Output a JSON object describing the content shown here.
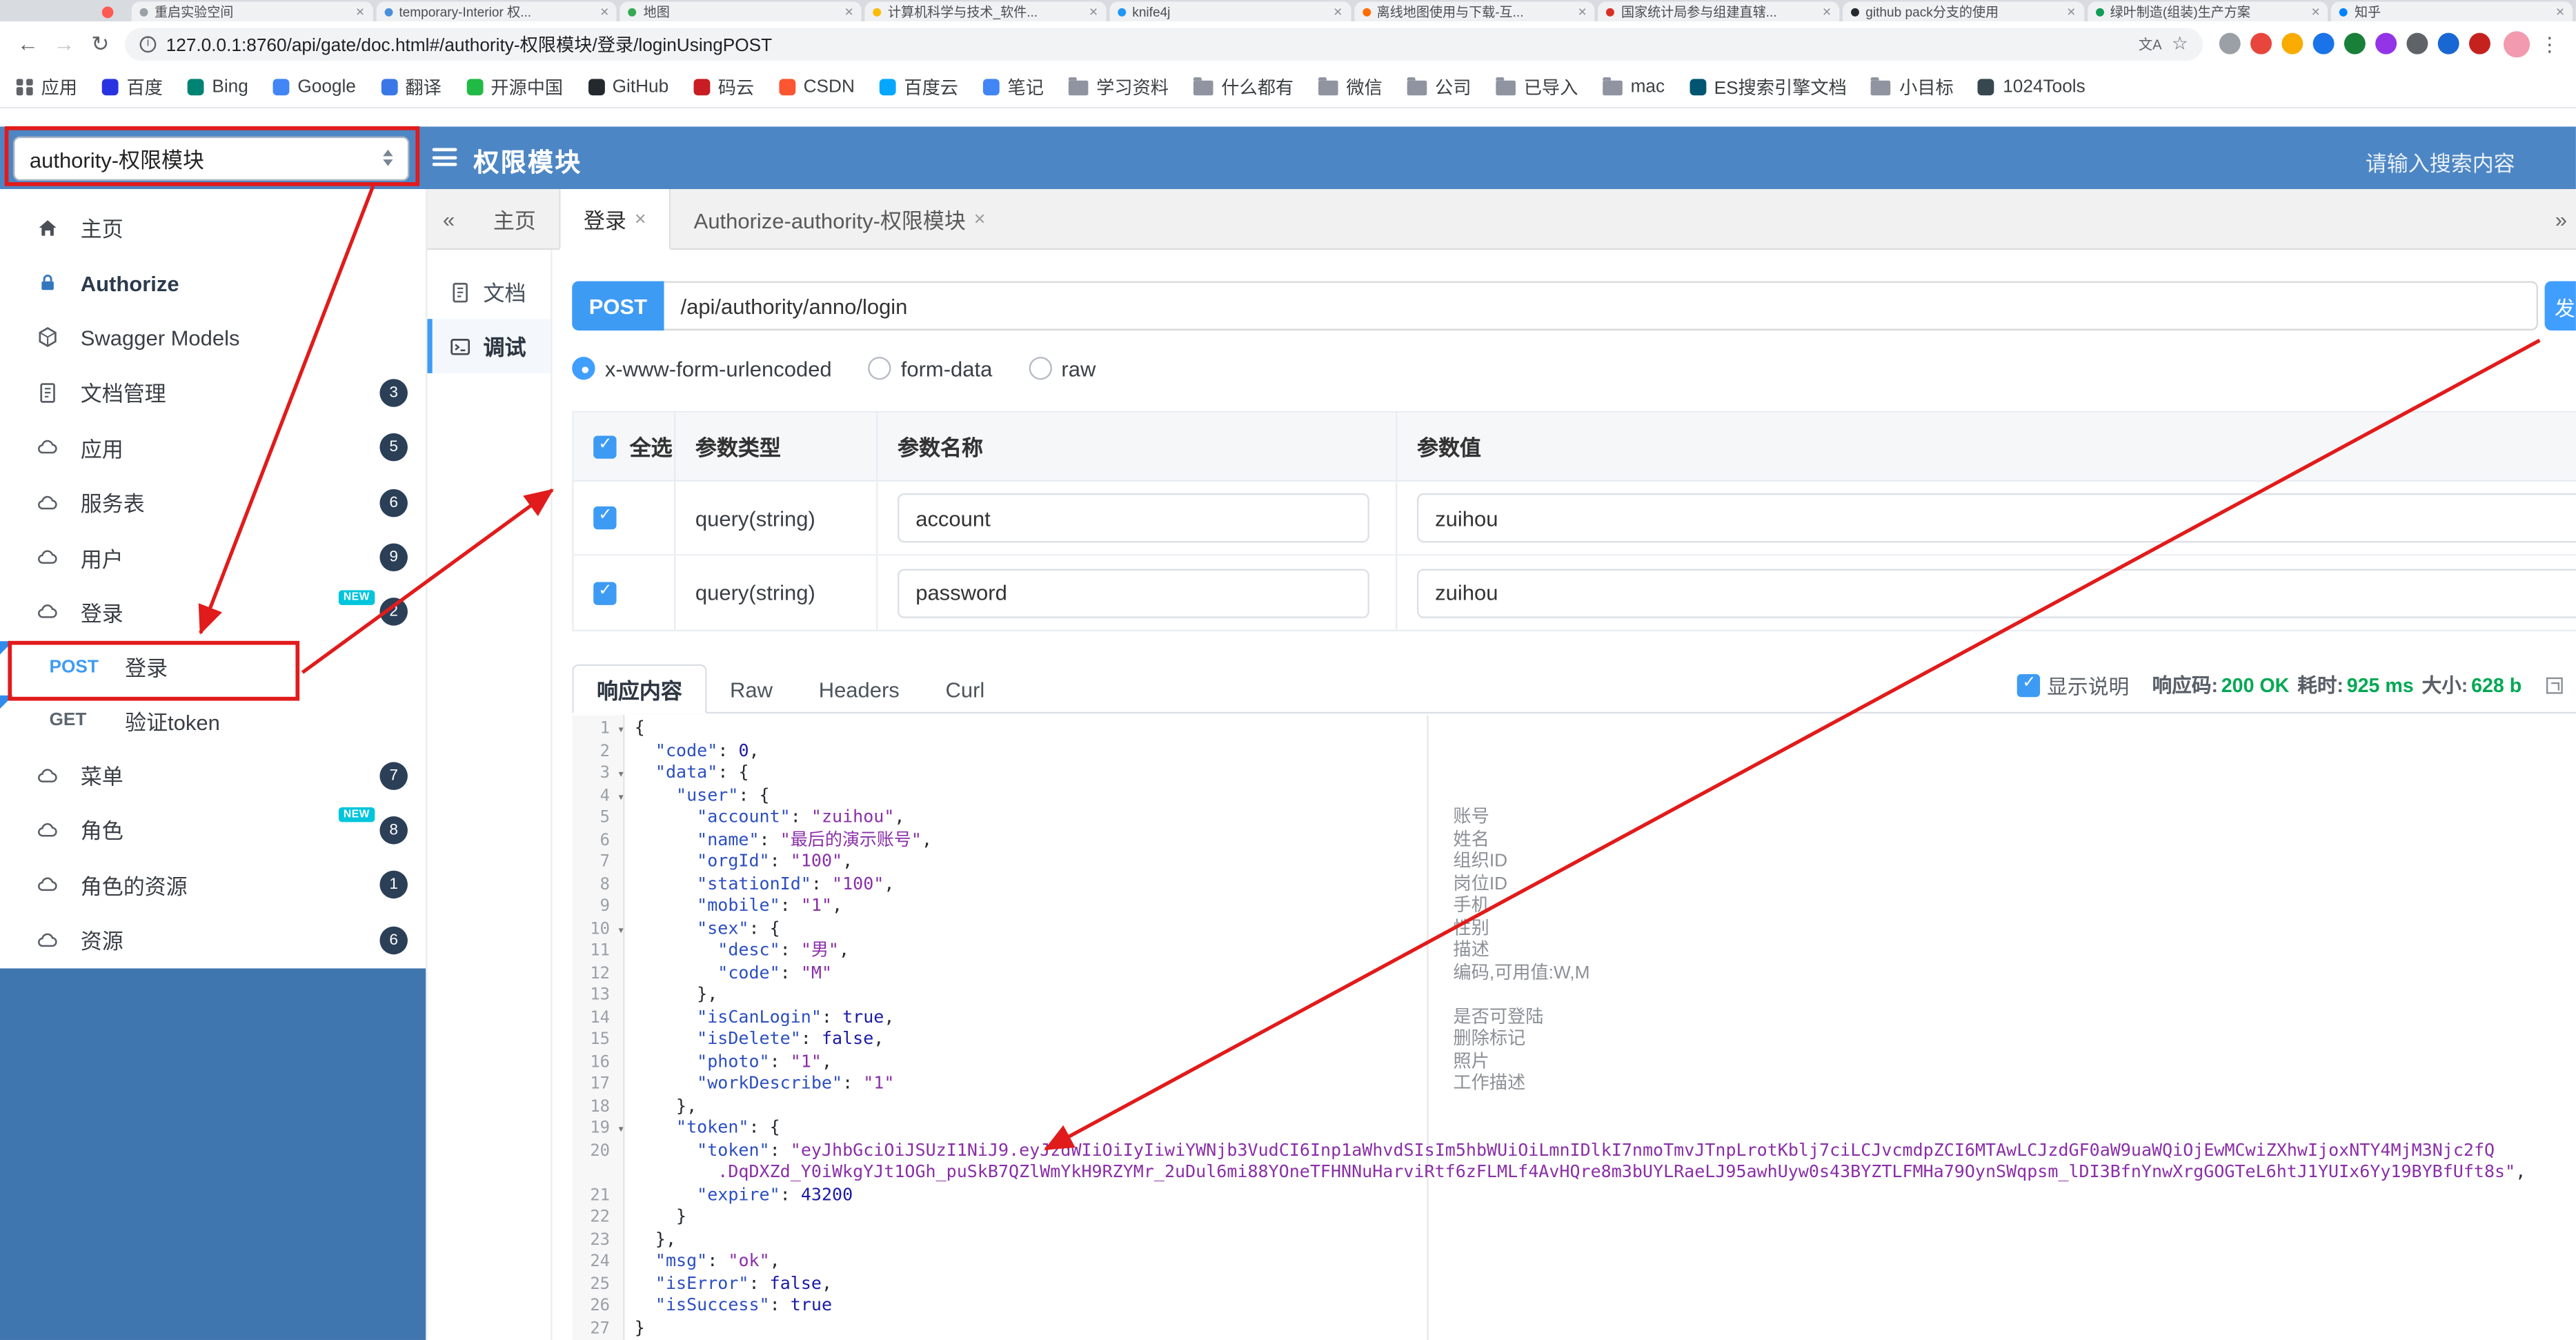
{
  "browser": {
    "tabs": [
      {
        "title": "重启实验空间",
        "color": "#9aa0a6"
      },
      {
        "title": "temporary-Interior 权...",
        "color": "#4a90d9"
      },
      {
        "title": "地图",
        "color": "#34a853"
      },
      {
        "title": "计算机科学与技术_软件...",
        "color": "#fbbc04"
      },
      {
        "title": "knife4j",
        "color": "#2196f3"
      },
      {
        "title": "离线地图使用与下载-互...",
        "color": "#ff6d00"
      },
      {
        "title": "国家统计局参与组建直辖...",
        "color": "#d93025"
      },
      {
        "title": "github pack分支的使用",
        "color": "#24292e"
      },
      {
        "title": "绿叶制造(组装)生产方案",
        "color": "#0f9d58"
      },
      {
        "title": "知乎",
        "color": "#0084ff"
      }
    ],
    "toolbar": {
      "back": "←",
      "forward": "→",
      "reload": "↻",
      "url": "127.0.0.1:8760/api/gate/doc.html#/authority-权限模块/登录/loginUsingPOST",
      "translate_hint": "文A",
      "star": "☆",
      "menu": "⋮",
      "extensions": [
        {
          "color": "#9aa0a6"
        },
        {
          "color": "#e8453c"
        },
        {
          "color": "#f9ab00"
        },
        {
          "color": "#1a73e8"
        },
        {
          "color": "#188038"
        },
        {
          "color": "#9334e6"
        },
        {
          "color": "#5f6368"
        },
        {
          "color": "#1967d2"
        },
        {
          "color": "#c5221f"
        }
      ]
    },
    "bookmarks": [
      {
        "label": "应用",
        "icon": "apps-icon"
      },
      {
        "label": "百度",
        "icon": "site-icon",
        "color": "#2932e1"
      },
      {
        "label": "Bing",
        "icon": "site-icon",
        "color": "#008373"
      },
      {
        "label": "Google",
        "icon": "site-icon",
        "color": "#4285f4"
      },
      {
        "label": "翻译",
        "icon": "site-icon",
        "color": "#3b78e7"
      },
      {
        "label": "开源中国",
        "icon": "site-icon",
        "color": "#21ba45"
      },
      {
        "label": "GitHub",
        "icon": "site-icon",
        "color": "#24292e"
      },
      {
        "label": "码云",
        "icon": "site-icon",
        "color": "#c71d23"
      },
      {
        "label": "CSDN",
        "icon": "site-icon",
        "color": "#fc5531"
      },
      {
        "label": "百度云",
        "icon": "site-icon",
        "color": "#06a7ff"
      },
      {
        "label": "笔记",
        "icon": "site-icon",
        "color": "#4285f4"
      },
      {
        "label": "学习资料",
        "icon": "folder-icon"
      },
      {
        "label": "什么都有",
        "icon": "folder-icon"
      },
      {
        "label": "微信",
        "icon": "folder-icon"
      },
      {
        "label": "公司",
        "icon": "folder-icon"
      },
      {
        "label": "已导入",
        "icon": "folder-icon"
      },
      {
        "label": "mac",
        "icon": "folder-icon"
      },
      {
        "label": "ES搜索引擎文档",
        "icon": "site-icon",
        "color": "#005571"
      },
      {
        "label": "小目标",
        "icon": "folder-icon"
      },
      {
        "label": "1024Tools",
        "icon": "site-icon",
        "color": "#37474f"
      }
    ]
  },
  "header": {
    "module_select": "authority-权限模块",
    "title": "权限模块",
    "search_placeholder": "请输入搜索内容"
  },
  "sidebar": {
    "new_label": "NEW",
    "items": [
      {
        "label": "主页",
        "icon": "home-icon"
      },
      {
        "label": "Authorize",
        "icon": "lock-icon",
        "bold": true
      },
      {
        "label": "Swagger Models",
        "icon": "models-icon"
      },
      {
        "label": "文档管理",
        "icon": "doc-icon",
        "badge": "3"
      },
      {
        "label": "应用",
        "icon": "cloud-icon",
        "badge": "5"
      },
      {
        "label": "服务表",
        "icon": "cloud-icon",
        "badge": "6"
      },
      {
        "label": "用户",
        "icon": "cloud-icon",
        "badge": "9"
      },
      {
        "label": "登录",
        "icon": "cloud-icon",
        "badge": "2",
        "new": true
      },
      {
        "method": "POST",
        "label": "登录",
        "boxed": true
      },
      {
        "method": "GET",
        "label": "验证token"
      },
      {
        "label": "菜单",
        "icon": "cloud-icon",
        "badge": "7"
      },
      {
        "label": "角色",
        "icon": "cloud-icon",
        "badge": "8",
        "new": true
      },
      {
        "label": "角色的资源",
        "icon": "cloud-icon",
        "badge": "1"
      },
      {
        "label": "资源",
        "icon": "cloud-icon",
        "badge": "6"
      }
    ]
  },
  "tabs_bar": {
    "collapse_left": "«",
    "collapse_right": "»",
    "close_glyph": "×",
    "items": [
      {
        "label": "主页",
        "closable": false,
        "active": false
      },
      {
        "label": "登录",
        "closable": true,
        "active": true
      },
      {
        "label": "Authorize-authority-权限模块",
        "closable": true,
        "active": false
      }
    ]
  },
  "doc_rail": {
    "items": [
      {
        "label": "文档",
        "icon": "doc-icon",
        "active": false
      },
      {
        "label": "调试",
        "icon": "debug-icon",
        "active": true
      }
    ]
  },
  "debug": {
    "method": "POST",
    "url": "/api/authority/anno/login",
    "send_label": "发送",
    "content_types": [
      {
        "label": "x-www-form-urlencoded",
        "selected": true
      },
      {
        "label": "form-data",
        "selected": false
      },
      {
        "label": "raw",
        "selected": false
      }
    ],
    "params": {
      "select_all_label": "全选",
      "select_all_checked": true,
      "columns": [
        "参数类型",
        "参数名称",
        "参数值"
      ],
      "rows": [
        {
          "checked": true,
          "type": "query(string)",
          "name": "account",
          "value": "zuihou"
        },
        {
          "checked": true,
          "type": "query(string)",
          "name": "password",
          "value": "zuihou"
        }
      ]
    },
    "response": {
      "tabs": [
        {
          "label": "响应内容",
          "active": true
        },
        {
          "label": "Raw",
          "active": false
        },
        {
          "label": "Headers",
          "active": false
        },
        {
          "label": "Curl",
          "active": false
        }
      ],
      "show_desc": {
        "checked": true,
        "label": "显示说明"
      },
      "status": [
        {
          "label": "响应码:",
          "value": "200 OK"
        },
        {
          "label": "耗时:",
          "value": "925 ms"
        },
        {
          "label": "大小:",
          "value": "628 b"
        }
      ]
    }
  },
  "code": {
    "lines": [
      {
        "n": "1",
        "f": true,
        "s": [
          [
            "p",
            "{"
          ]
        ]
      },
      {
        "n": "2",
        "s": [
          [
            "p",
            "  "
          ],
          [
            "k",
            "\"code\""
          ],
          [
            "p",
            ": "
          ],
          [
            "d",
            "0"
          ],
          [
            "p",
            ","
          ]
        ]
      },
      {
        "n": "3",
        "f": true,
        "s": [
          [
            "p",
            "  "
          ],
          [
            "k",
            "\"data\""
          ],
          [
            "p",
            ": {"
          ]
        ]
      },
      {
        "n": "4",
        "f": true,
        "s": [
          [
            "p",
            "    "
          ],
          [
            "k",
            "\"user\""
          ],
          [
            "p",
            ": {"
          ]
        ]
      },
      {
        "n": "5",
        "s": [
          [
            "p",
            "      "
          ],
          [
            "k",
            "\"account\""
          ],
          [
            "p",
            ": "
          ],
          [
            "s",
            "\"zuihou\""
          ],
          [
            "p",
            ","
          ]
        ]
      },
      {
        "n": "6",
        "s": [
          [
            "p",
            "      "
          ],
          [
            "k",
            "\"name\""
          ],
          [
            "p",
            ": "
          ],
          [
            "s",
            "\"最后的演示账号\""
          ],
          [
            "p",
            ","
          ]
        ]
      },
      {
        "n": "7",
        "s": [
          [
            "p",
            "      "
          ],
          [
            "k",
            "\"orgId\""
          ],
          [
            "p",
            ": "
          ],
          [
            "s",
            "\"100\""
          ],
          [
            "p",
            ","
          ]
        ]
      },
      {
        "n": "8",
        "s": [
          [
            "p",
            "      "
          ],
          [
            "k",
            "\"stationId\""
          ],
          [
            "p",
            ": "
          ],
          [
            "s",
            "\"100\""
          ],
          [
            "p",
            ","
          ]
        ]
      },
      {
        "n": "9",
        "s": [
          [
            "p",
            "      "
          ],
          [
            "k",
            "\"mobile\""
          ],
          [
            "p",
            ": "
          ],
          [
            "s",
            "\"1\""
          ],
          [
            "p",
            ","
          ]
        ]
      },
      {
        "n": "10",
        "f": true,
        "s": [
          [
            "p",
            "      "
          ],
          [
            "k",
            "\"sex\""
          ],
          [
            "p",
            ": {"
          ]
        ]
      },
      {
        "n": "11",
        "s": [
          [
            "p",
            "        "
          ],
          [
            "k",
            "\"desc\""
          ],
          [
            "p",
            ": "
          ],
          [
            "s",
            "\"男\""
          ],
          [
            "p",
            ","
          ]
        ]
      },
      {
        "n": "12",
        "s": [
          [
            "p",
            "        "
          ],
          [
            "k",
            "\"code\""
          ],
          [
            "p",
            ": "
          ],
          [
            "s",
            "\"M\""
          ]
        ]
      },
      {
        "n": "13",
        "s": [
          [
            "p",
            "      },"
          ]
        ]
      },
      {
        "n": "14",
        "s": [
          [
            "p",
            "      "
          ],
          [
            "k",
            "\"isCanLogin\""
          ],
          [
            "p",
            ": "
          ],
          [
            "b",
            "true"
          ],
          [
            "p",
            ","
          ]
        ]
      },
      {
        "n": "15",
        "s": [
          [
            "p",
            "      "
          ],
          [
            "k",
            "\"isDelete\""
          ],
          [
            "p",
            ": "
          ],
          [
            "b",
            "false"
          ],
          [
            "p",
            ","
          ]
        ]
      },
      {
        "n": "16",
        "s": [
          [
            "p",
            "      "
          ],
          [
            "k",
            "\"photo\""
          ],
          [
            "p",
            ": "
          ],
          [
            "s",
            "\"1\""
          ],
          [
            "p",
            ","
          ]
        ]
      },
      {
        "n": "17",
        "s": [
          [
            "p",
            "      "
          ],
          [
            "k",
            "\"workDescribe\""
          ],
          [
            "p",
            ": "
          ],
          [
            "s",
            "\"1\""
          ]
        ]
      },
      {
        "n": "18",
        "s": [
          [
            "p",
            "    },"
          ]
        ]
      },
      {
        "n": "19",
        "f": true,
        "s": [
          [
            "p",
            "    "
          ],
          [
            "k",
            "\"token\""
          ],
          [
            "p",
            ": {"
          ]
        ]
      },
      {
        "n": "20",
        "s": [
          [
            "p",
            "      "
          ],
          [
            "k",
            "\"token\""
          ],
          [
            "p",
            ": "
          ],
          [
            "s",
            "\"eyJhbGciOiJSUzI1NiJ9.eyJzdWIiOiIyIiwiYWNjb3VudCI6Inp1aWhvdSIsIm5hbWUiOiLmnIDlkI7nmoTmvJTnpLrotKblj7ciLCJvcmdpZCI6MTAwLCJzdGF0aW9uaWQiOjEwMCwiZXhwIjoxNTY4MjM3Njc2fQ"
          ]
        ]
      },
      {
        "n": "",
        "s": [
          [
            "p",
            "        "
          ],
          [
            "s",
            ".DqDXZd_Y0iWkgYJt1OGh_puSkB7QZlWmYkH9RZYMr_2uDul6mi88YOneTFHNNuHarviRtf6zFLMLf4AvHQre8m3bUYLRaeLJ95awhUyw0s43BYZTLFMHa79OynSWqpsm_lDI3BfnYnwXrgGOGTeL6htJ1YUIx6Yy19BYBfUft8s\""
          ],
          [
            "p",
            ","
          ]
        ]
      },
      {
        "n": "21",
        "s": [
          [
            "p",
            "      "
          ],
          [
            "k",
            "\"expire\""
          ],
          [
            "p",
            ": "
          ],
          [
            "d",
            "43200"
          ]
        ]
      },
      {
        "n": "22",
        "s": [
          [
            "p",
            "    }"
          ]
        ]
      },
      {
        "n": "23",
        "s": [
          [
            "p",
            "  },"
          ]
        ]
      },
      {
        "n": "24",
        "s": [
          [
            "p",
            "  "
          ],
          [
            "k",
            "\"msg\""
          ],
          [
            "p",
            ": "
          ],
          [
            "s",
            "\"ok\""
          ],
          [
            "p",
            ","
          ]
        ]
      },
      {
        "n": "25",
        "s": [
          [
            "p",
            "  "
          ],
          [
            "k",
            "\"isError\""
          ],
          [
            "p",
            ": "
          ],
          [
            "b",
            "false"
          ],
          [
            "p",
            ","
          ]
        ]
      },
      {
        "n": "26",
        "s": [
          [
            "p",
            "  "
          ],
          [
            "k",
            "\"isSuccess\""
          ],
          [
            "p",
            ": "
          ],
          [
            "b",
            "true"
          ]
        ]
      },
      {
        "n": "27",
        "s": [
          [
            "p",
            "}"
          ]
        ]
      }
    ],
    "annotations": [
      {
        "line": 5,
        "text": "账号"
      },
      {
        "line": 6,
        "text": "姓名"
      },
      {
        "line": 7,
        "text": "组织ID"
      },
      {
        "line": 8,
        "text": "岗位ID"
      },
      {
        "line": 9,
        "text": "手机"
      },
      {
        "line": 10,
        "text": "性别"
      },
      {
        "line": 11,
        "text": "描述"
      },
      {
        "line": 12,
        "text": "编码,可用值:W,M"
      },
      {
        "line": 14,
        "text": "是否可登陆"
      },
      {
        "line": 15,
        "text": "删除标记"
      },
      {
        "line": 16,
        "text": "照片"
      },
      {
        "line": 17,
        "text": "工作描述"
      }
    ]
  }
}
